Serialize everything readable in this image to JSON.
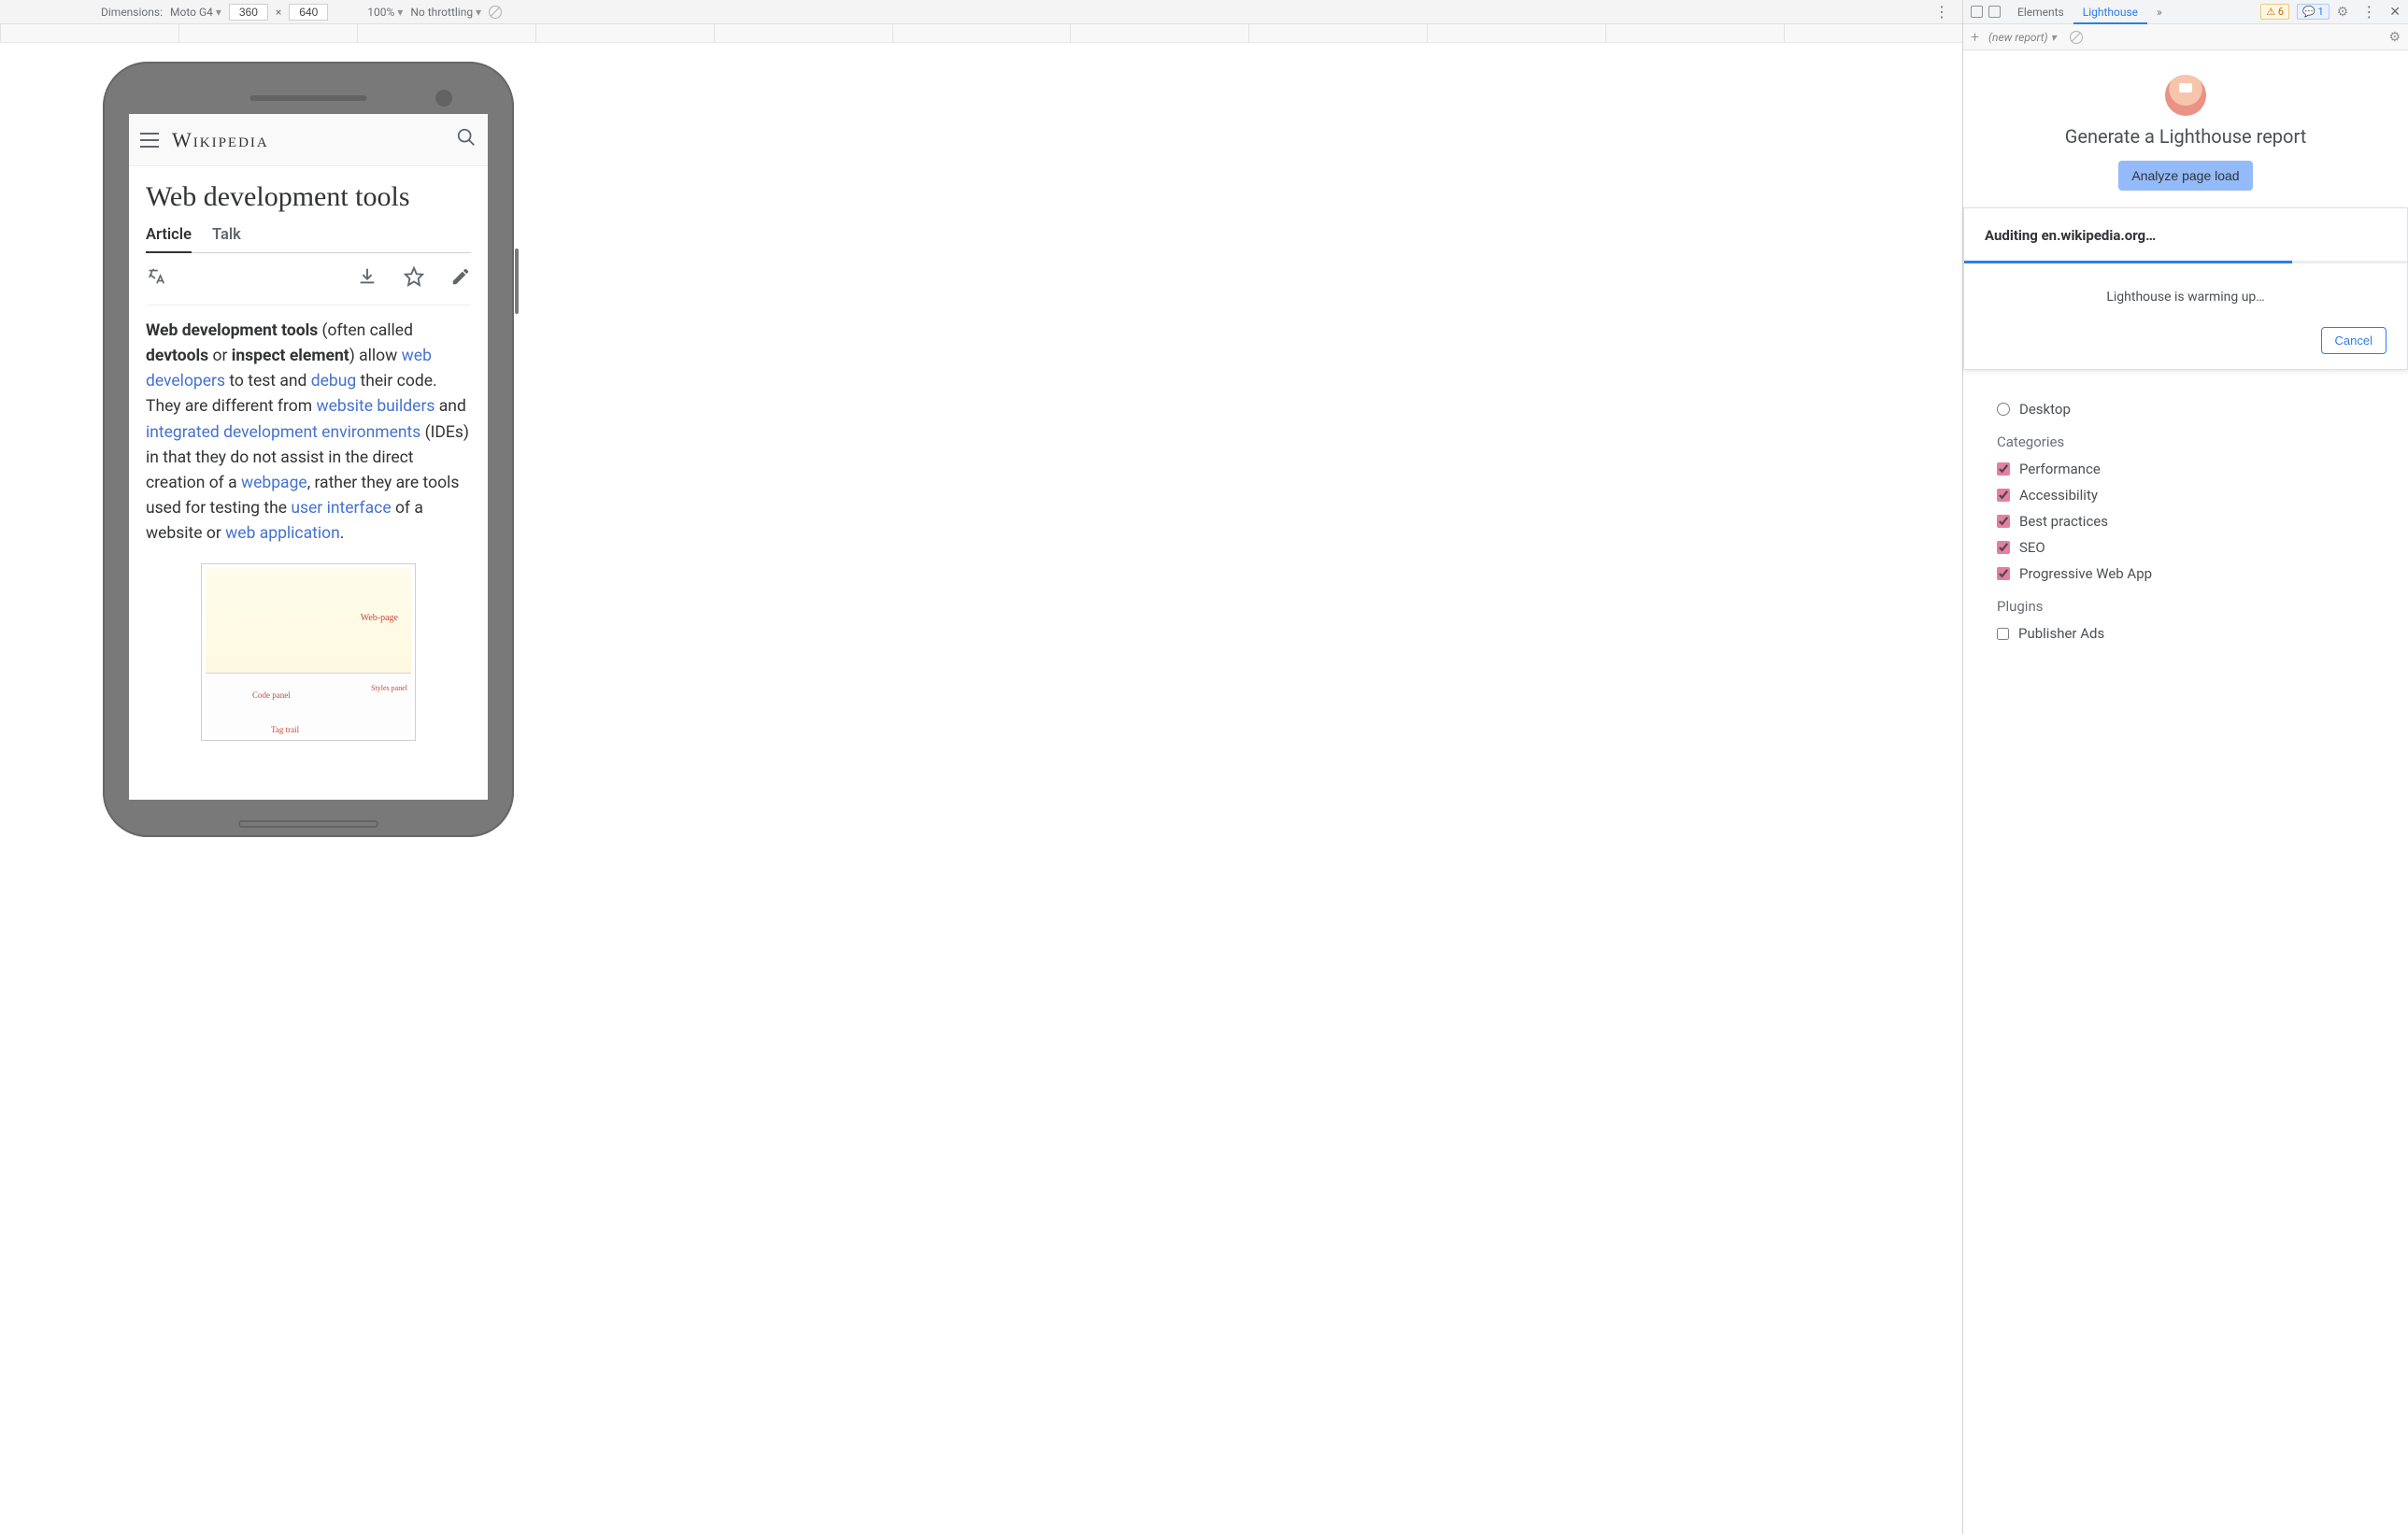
{
  "device_toolbar": {
    "dimensions_label": "Dimensions:",
    "device_name": "Moto G4",
    "width": "360",
    "times": "×",
    "height": "640",
    "zoom": "100%",
    "throttling": "No throttling"
  },
  "wikipedia": {
    "logo": "Wikipedia",
    "title": "Web development tools",
    "tabs": {
      "article": "Article",
      "talk": "Talk"
    },
    "para": {
      "b1": "Web development tools",
      "t1": " (often called ",
      "b2": "devtools",
      "t2": " or ",
      "b3": "inspect element",
      "t3": ") allow ",
      "a1": "web developers",
      "t4": " to test and ",
      "a2": "debug",
      "t5": " their code. They are different from ",
      "a3": "website builders",
      "t6": " and ",
      "a4": "integrated development environments",
      "t7": " (IDEs) in that they do not assist in the direct creation of a ",
      "a5": "webpage",
      "t8": ", rather they are tools used for testing the ",
      "a6": "user interface",
      "t9": " of a website or ",
      "a7": "web application",
      "t10": "."
    },
    "figure": {
      "webpage": "Web-page",
      "codepanel": "Code panel",
      "stylespanel": "Styles panel",
      "tagtrail": "Tag trail"
    }
  },
  "devtools": {
    "tabs": {
      "elements": "Elements",
      "lighthouse": "Lighthouse"
    },
    "warn_count": "6",
    "info_count": "1",
    "new_report": "(new report)"
  },
  "lighthouse": {
    "title": "Generate a Lighthouse report",
    "analyze": "Analyze page load",
    "device_desktop": "Desktop",
    "categories_head": "Categories",
    "categories": {
      "performance": "Performance",
      "accessibility": "Accessibility",
      "best": "Best practices",
      "seo": "SEO",
      "pwa": "Progressive Web App"
    },
    "plugins_head": "Plugins",
    "plugins": {
      "publisher": "Publisher Ads"
    }
  },
  "audit": {
    "title": "Auditing en.wikipedia.org…",
    "status": "Lighthouse is warming up…",
    "cancel": "Cancel"
  }
}
